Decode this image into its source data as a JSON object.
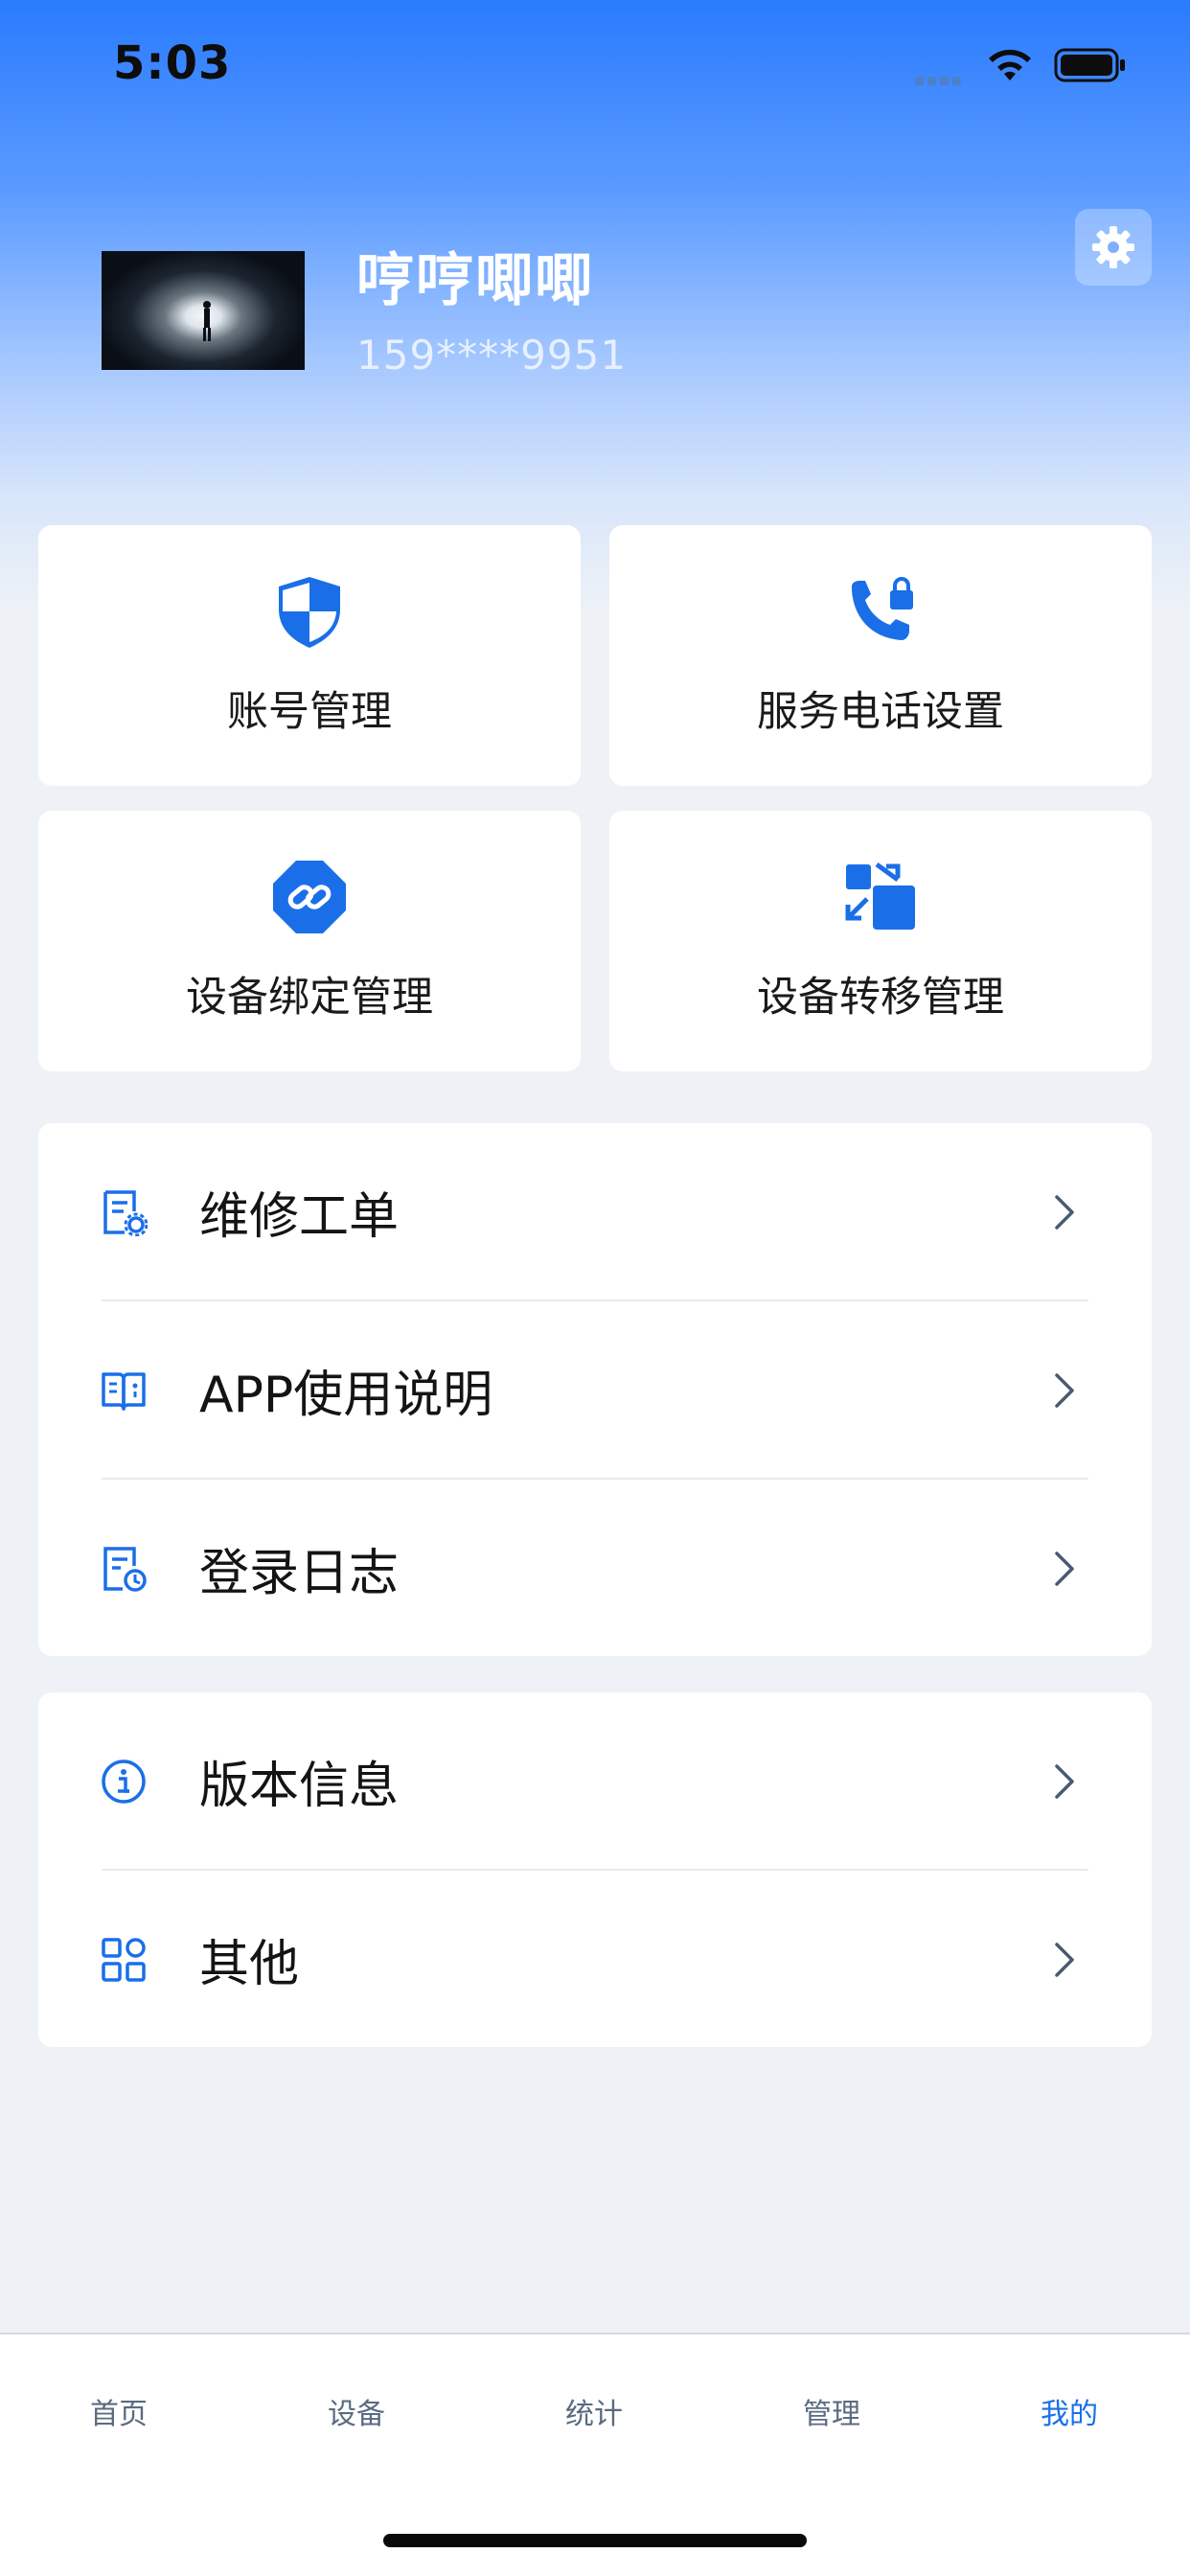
{
  "status_bar": {
    "time": "5:03"
  },
  "profile": {
    "name": "哼哼唧唧",
    "phone": "159****9951"
  },
  "quick_actions": [
    {
      "label": "账号管理",
      "icon": "shield-icon"
    },
    {
      "label": "服务电话设置",
      "icon": "phone-lock-icon"
    },
    {
      "label": "设备绑定管理",
      "icon": "link-icon"
    },
    {
      "label": "设备转移管理",
      "icon": "transfer-icon"
    }
  ],
  "menu_section_1": [
    {
      "label": "维修工单",
      "icon": "repair-order-icon"
    },
    {
      "label": "APP使用说明",
      "icon": "manual-book-icon"
    },
    {
      "label": "登录日志",
      "icon": "log-clock-icon"
    }
  ],
  "menu_section_2": [
    {
      "label": "版本信息",
      "icon": "info-icon"
    },
    {
      "label": "其他",
      "icon": "grid-icon"
    }
  ],
  "tabbar": {
    "items": [
      "首页",
      "设备",
      "统计",
      "管理",
      "我的"
    ],
    "active": "我的"
  },
  "colors": {
    "accent": "#1a6fe8",
    "header_top": "#2a7bff",
    "background": "#eef2f7"
  }
}
